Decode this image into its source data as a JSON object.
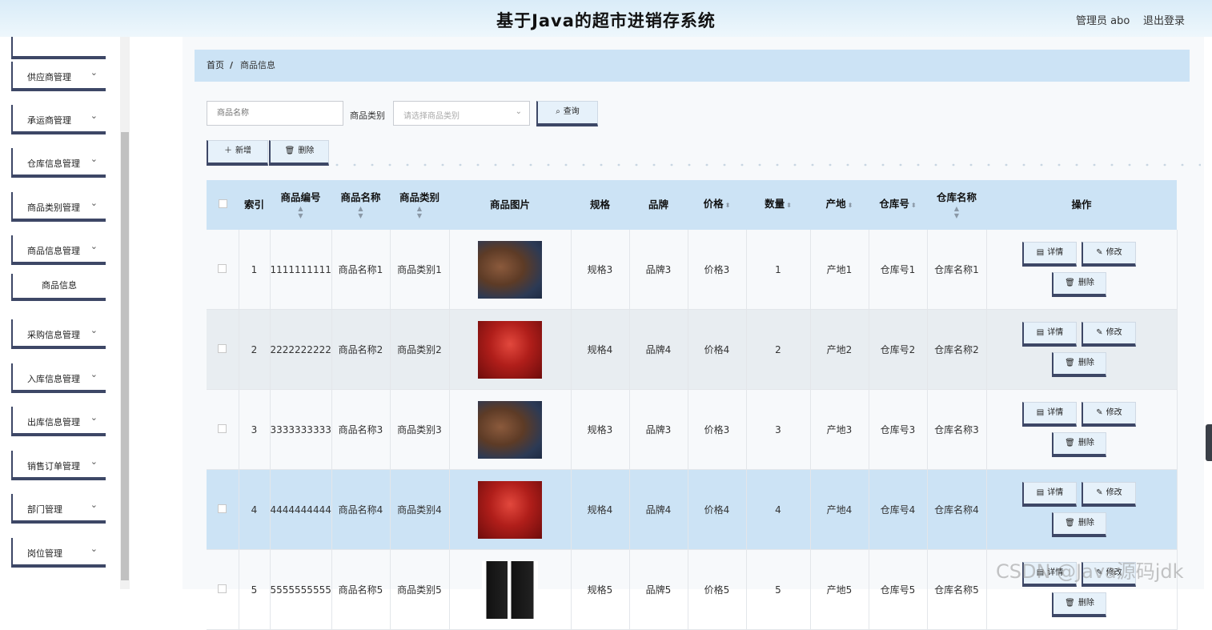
{
  "header": {
    "title": "基于Java的超市进销存系统",
    "admin": "管理员 abo",
    "logout": "退出登录"
  },
  "sidebar": {
    "items": [
      {
        "label": "供应商管理"
      },
      {
        "label": "承运商管理"
      },
      {
        "label": "仓库信息管理"
      },
      {
        "label": "商品类别管理"
      },
      {
        "label": "商品信息管理"
      },
      {
        "label": "采购信息管理"
      },
      {
        "label": "入库信息管理"
      },
      {
        "label": "出库信息管理"
      },
      {
        "label": "销售订单管理"
      },
      {
        "label": "部门管理"
      },
      {
        "label": "岗位管理"
      }
    ],
    "sub_item": "商品信息"
  },
  "breadcrumb": {
    "home": "首页",
    "sep": "/",
    "current": "商品信息"
  },
  "search": {
    "name_placeholder": "商品名称",
    "category_label": "商品类别",
    "category_placeholder": "请选择商品类别",
    "query_label": "查询"
  },
  "toolbar": {
    "add_label": "新增",
    "delete_label": "删除"
  },
  "table": {
    "headers": {
      "index": "索引",
      "code": "商品编号",
      "name": "商品名称",
      "category": "商品类别",
      "image": "商品图片",
      "spec": "规格",
      "brand": "品牌",
      "price": "价格",
      "qty": "数量",
      "origin": "产地",
      "warehouse_no": "仓库号",
      "warehouse_name": "仓库名称",
      "ops": "操作"
    },
    "rows": [
      {
        "index": "1",
        "code": "1111111111",
        "name": "商品名称1",
        "category": "商品类别1",
        "image": "bag",
        "spec": "规格3",
        "brand": "品牌3",
        "price": "价格3",
        "qty": "1",
        "origin": "产地1",
        "warehouse_no": "仓库号1",
        "warehouse_name": "仓库名称1"
      },
      {
        "index": "2",
        "code": "2222222222",
        "name": "商品名称2",
        "category": "商品类别2",
        "image": "gift",
        "spec": "规格4",
        "brand": "品牌4",
        "price": "价格4",
        "qty": "2",
        "origin": "产地2",
        "warehouse_no": "仓库号2",
        "warehouse_name": "仓库名称2"
      },
      {
        "index": "3",
        "code": "3333333333",
        "name": "商品名称3",
        "category": "商品类别3",
        "image": "bag",
        "spec": "规格3",
        "brand": "品牌3",
        "price": "价格3",
        "qty": "3",
        "origin": "产地3",
        "warehouse_no": "仓库号3",
        "warehouse_name": "仓库名称3"
      },
      {
        "index": "4",
        "code": "4444444444",
        "name": "商品名称4",
        "category": "商品类别4",
        "image": "gift",
        "spec": "规格4",
        "brand": "品牌4",
        "price": "价格4",
        "qty": "4",
        "origin": "产地4",
        "warehouse_no": "仓库号4",
        "warehouse_name": "仓库名称4"
      },
      {
        "index": "5",
        "code": "5555555555",
        "name": "商品名称5",
        "category": "商品类别5",
        "image": "bottle",
        "spec": "规格5",
        "brand": "品牌5",
        "price": "价格5",
        "qty": "5",
        "origin": "产地5",
        "warehouse_no": "仓库号5",
        "warehouse_name": "仓库名称5"
      }
    ],
    "ops": {
      "detail": "详情",
      "edit": "修改",
      "delete": "删除"
    }
  },
  "watermark": "CSDN @Java源码jdk"
}
